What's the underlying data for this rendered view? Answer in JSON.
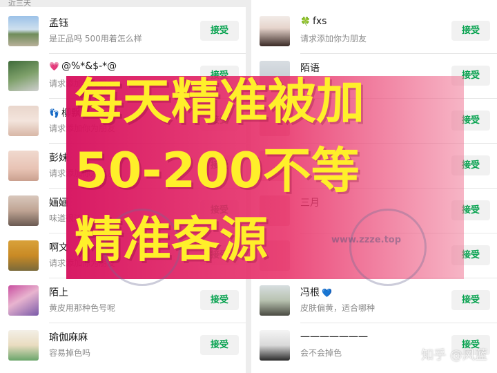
{
  "left_panel": {
    "section_label": "近三天",
    "requests": [
      {
        "name": "孟钰",
        "emoji": "",
        "message": "是正品吗 500用着怎么样",
        "accept": "接受"
      },
      {
        "name": "@%*&$-*@",
        "emoji": "💗",
        "message": "请求添加你为朋友",
        "accept": "接受"
      },
      {
        "name": "柳飘",
        "emoji": "👣",
        "message": "请求添加你为朋友",
        "accept": "接受"
      },
      {
        "name": "彭妹",
        "emoji": "",
        "message": "请求添加你为朋友",
        "accept": "接受"
      },
      {
        "name": "婳婳",
        "emoji": "",
        "message": "味道很浓吗",
        "accept": "接受"
      },
      {
        "name": "啊文",
        "emoji": "",
        "message": "请求添加你为朋友",
        "accept": "接受"
      },
      {
        "name": "陌上",
        "emoji": "",
        "message": "黄皮用那种色号呢",
        "accept": "接受"
      },
      {
        "name": "瑜伽麻麻",
        "emoji": "",
        "message": "容易掉色吗",
        "accept": "接受"
      }
    ]
  },
  "right_panel": {
    "requests": [
      {
        "name": "fxs",
        "emoji": "🍀",
        "message": "请求添加你为朋友",
        "accept": "接受"
      },
      {
        "name": "陌语",
        "emoji": "",
        "message": "",
        "accept": "接受"
      },
      {
        "name": "",
        "emoji": "",
        "message": "",
        "accept": "接受"
      },
      {
        "name": "",
        "emoji": "",
        "message": "",
        "accept": "接受"
      },
      {
        "name": "三月",
        "emoji": "",
        "message": "",
        "accept": "接受"
      },
      {
        "name": "",
        "emoji": "",
        "message": "",
        "accept": "接受"
      },
      {
        "name": "冯根",
        "emoji": "💙",
        "message": "皮肤偏黄，适合哪种",
        "accept": "接受"
      },
      {
        "name": "一一一一一一一",
        "emoji": "",
        "message": "会不会掉色",
        "accept": "接受"
      }
    ]
  },
  "overlay": {
    "line1": "每天精准被加",
    "line2": "50-200不等",
    "line3": "精准客源",
    "stamp_text": "www.zzze.top"
  },
  "watermark": "知乎 @风蓝",
  "colors": {
    "accept_text": "#07a24f",
    "banner": "#d60e5c",
    "headline": "#ffef2a"
  }
}
